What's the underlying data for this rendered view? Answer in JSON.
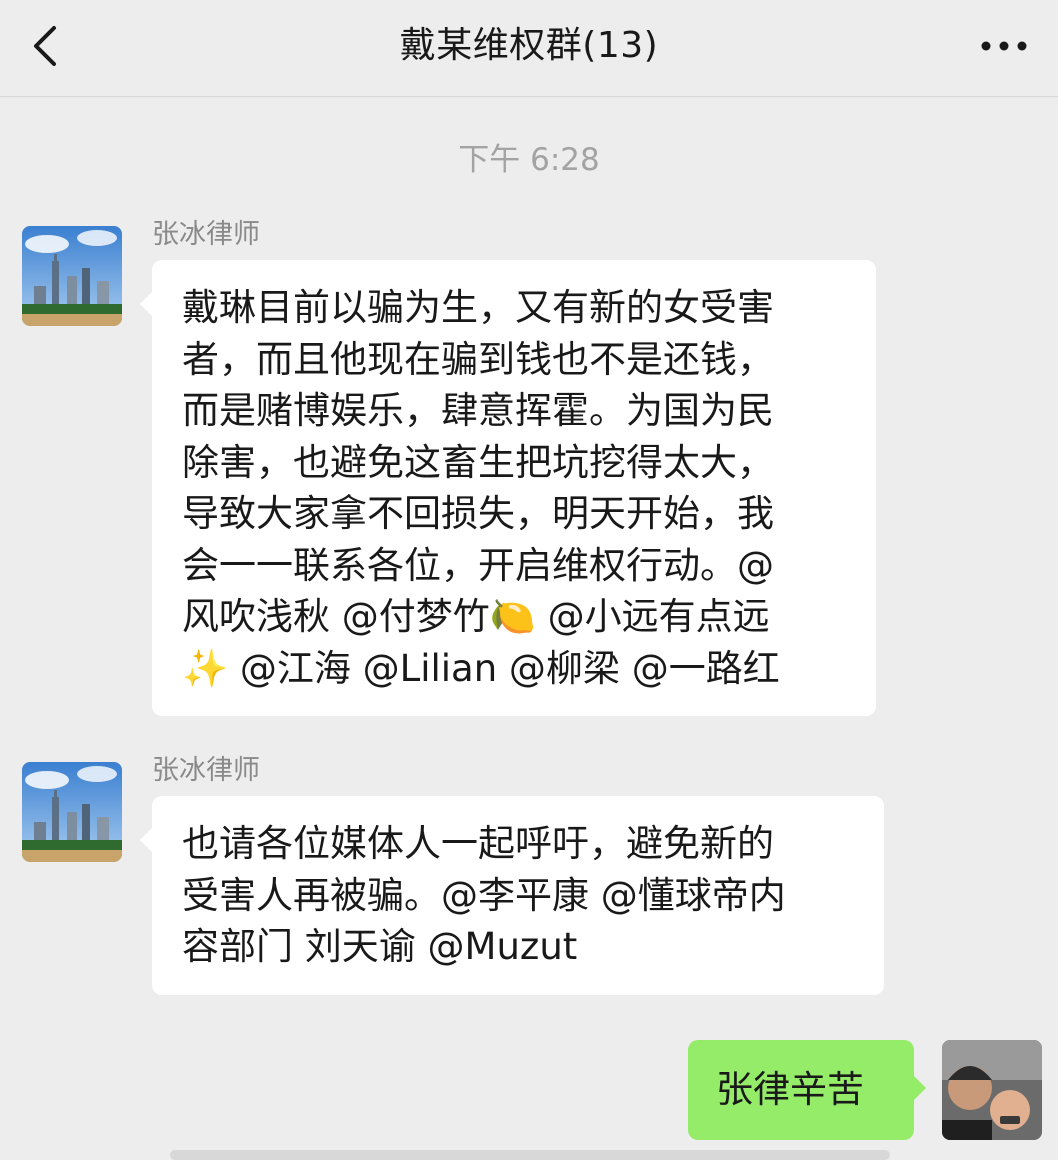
{
  "header": {
    "back_icon": "chevron-left-icon",
    "title": "戴某维权群(13)",
    "more_icon": "more-dots-icon"
  },
  "timestamp": "下午 6:28",
  "messages": [
    {
      "sender": "张冰律师",
      "avatar": "city-skyline-avatar",
      "text": "戴琳目前以骗为生，又有新的女受害\n者，而且他现在骗到钱也不是还钱，\n而是赌博娱乐，肆意挥霍。为国为民\n除害，也避免这畜生把坑挖得太大，\n导致大家拿不回损失，明天开始，我\n会一一联系各位，开启维权行动。@\n风吹浅秋 @付梦竹🍋 @小远有点远\n✨ @江海 @Lilian @柳梁 @一路红"
    },
    {
      "sender": "张冰律师",
      "avatar": "city-skyline-avatar",
      "text": "也请各位媒体人一起呼吁，避免新的\n受害人再被骗。@李平康 @懂球帝内\n容部门 刘天谕 @Muzut"
    },
    {
      "sender": "",
      "avatar": "user-photo-avatar",
      "text": "张律辛苦"
    }
  ],
  "colors": {
    "background": "#ededed",
    "incoming_bubble": "#ffffff",
    "outgoing_bubble": "#95ec69"
  }
}
